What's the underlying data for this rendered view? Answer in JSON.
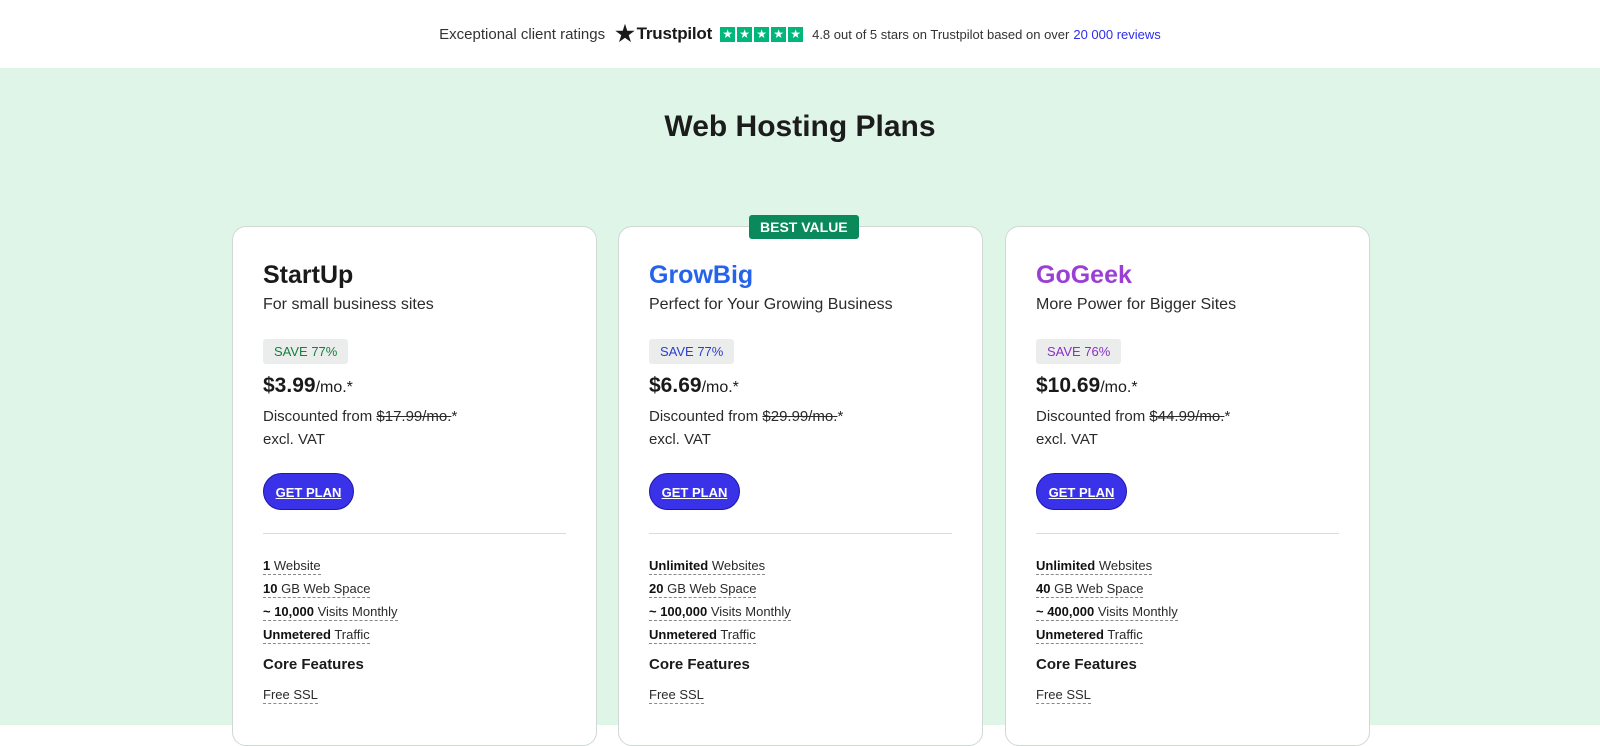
{
  "trustbar": {
    "lead": "Exceptional client ratings",
    "brand": "Trustpilot",
    "rating_text": "4.8 out of 5 stars on Trustpilot based on over",
    "reviews_link": "20 000 reviews",
    "star_color": "#00b67a"
  },
  "section": {
    "title": "Web Hosting Plans"
  },
  "plans": [
    {
      "name": "StartUp",
      "name_color": "#1a1a1a",
      "subtitle": "For small business sites",
      "save": "SAVE 77%",
      "save_color": "#15803d",
      "price": "$3.99",
      "per": "/mo.*",
      "disc_prefix": "Discounted from",
      "old_price": "$17.99/mo.",
      "disc_suffix": "*",
      "vat": "excl. VAT",
      "button": "GET PLAN",
      "features": [
        {
          "bold": "1",
          "rest": "Website"
        },
        {
          "bold": "10",
          "rest": "GB Web Space"
        },
        {
          "bold": "~ 10,000",
          "rest": "Visits Monthly"
        },
        {
          "bold": "Unmetered",
          "rest": "Traffic"
        }
      ],
      "core_title": "Core Features",
      "core_items": [
        "Free SSL"
      ]
    },
    {
      "name": "GrowBig",
      "name_color": "#2563eb",
      "badge": "BEST VALUE",
      "subtitle": "Perfect for Your Growing Business",
      "save": "SAVE 77%",
      "save_color": "#2b3ecf",
      "price": "$6.69",
      "per": "/mo.*",
      "disc_prefix": "Discounted from",
      "old_price": "$29.99/mo.",
      "disc_suffix": "*",
      "vat": "excl. VAT",
      "button": "GET PLAN",
      "features": [
        {
          "bold": "Unlimited",
          "rest": "Websites"
        },
        {
          "bold": "20",
          "rest": "GB Web Space"
        },
        {
          "bold": "~ 100,000",
          "rest": "Visits Monthly"
        },
        {
          "bold": "Unmetered",
          "rest": "Traffic"
        }
      ],
      "core_title": "Core Features",
      "core_items": [
        "Free SSL"
      ]
    },
    {
      "name": "GoGeek",
      "name_color": "#9b3fd4",
      "subtitle": "More Power for Bigger Sites",
      "save": "SAVE 76%",
      "save_color": "#8b2fc9",
      "price": "$10.69",
      "per": "/mo.*",
      "disc_prefix": "Discounted from",
      "old_price": "$44.99/mo.",
      "disc_suffix": "*",
      "vat": "excl. VAT",
      "button": "GET PLAN",
      "features": [
        {
          "bold": "Unlimited",
          "rest": "Websites"
        },
        {
          "bold": "40",
          "rest": "GB Web Space"
        },
        {
          "bold": "~ 400,000",
          "rest": "Visits Monthly"
        },
        {
          "bold": "Unmetered",
          "rest": "Traffic"
        }
      ],
      "core_title": "Core Features",
      "core_items": [
        "Free SSL"
      ]
    }
  ],
  "colors": {
    "section_bg": "#dff5e8",
    "button_bg": "#3a32e8",
    "best_value_bg": "#0a8a5b"
  }
}
